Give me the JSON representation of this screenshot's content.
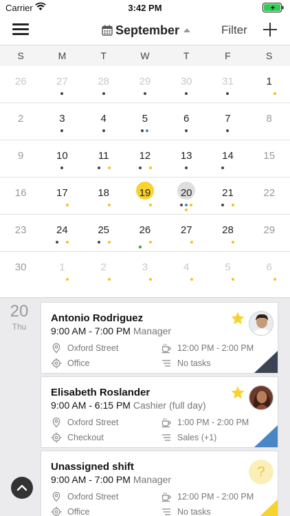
{
  "status": {
    "carrier": "Carrier",
    "time": "3:42 PM"
  },
  "toolbar": {
    "month": "September",
    "filter": "Filter"
  },
  "weekdays": [
    "S",
    "M",
    "T",
    "W",
    "T",
    "F",
    "S"
  ],
  "weeks": [
    [
      "26",
      "27",
      "28",
      "29",
      "30",
      "31",
      "1"
    ],
    [
      "2",
      "3",
      "4",
      "5",
      "6",
      "7",
      "8"
    ],
    [
      "9",
      "10",
      "11",
      "12",
      "13",
      "14",
      "15"
    ],
    [
      "16",
      "17",
      "18",
      "19",
      "20",
      "21",
      "22"
    ],
    [
      "23",
      "24",
      "25",
      "26",
      "27",
      "28",
      "29"
    ],
    [
      "30",
      "1",
      "2",
      "3",
      "4",
      "5",
      "6"
    ]
  ],
  "selected_date": {
    "day": "20",
    "weekday": "Thu"
  },
  "shifts": [
    {
      "name": "Antonio Rodriguez",
      "hours": "9:00 AM - 7:00 PM",
      "role": "Manager",
      "location": "Oxford Street",
      "break": "12:00 PM - 2:00 PM",
      "position": "Office",
      "tasks": "No tasks"
    },
    {
      "name": "Elisabeth Roslander",
      "hours": "9:00 AM - 6:15 PM",
      "role": "Cashier (full day)",
      "location": "Oxford Street",
      "break": "1:00 PM - 2:00 PM",
      "position": "Checkout",
      "tasks": "Sales (+1)"
    },
    {
      "name": "Unassigned shift",
      "hours": "9:00 AM - 7:00 PM",
      "role": "Manager",
      "location": "Oxford Street",
      "break": "12:00 PM - 2:00 PM",
      "position": "Office",
      "tasks": "No tasks",
      "placeholder_icon": "?"
    }
  ],
  "colors": {
    "today": "#f6d32e",
    "dark": "#3a4452",
    "yellow": "#f2c417",
    "blue": "#4a86c5",
    "green": "#2aa53a"
  }
}
